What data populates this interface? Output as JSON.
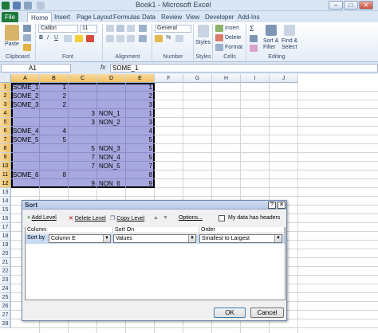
{
  "window": {
    "title": "Book1 - Microsoft Excel",
    "controls": [
      "−",
      "□",
      "✕"
    ]
  },
  "ribbon": {
    "tabs": [
      "File",
      "Home",
      "Insert",
      "Page Layout",
      "Formulas",
      "Data",
      "Review",
      "View",
      "Developer",
      "Add-Ins"
    ],
    "groups": {
      "clipboard": {
        "label": "Clipboard",
        "paste": "Paste"
      },
      "font": {
        "label": "Font",
        "name": "Calibri",
        "size": "11"
      },
      "alignment": {
        "label": "Alignment"
      },
      "number": {
        "label": "Number",
        "format": "General"
      },
      "styles": {
        "label": "Styles"
      },
      "cells": {
        "label": "Cells",
        "insert": "Insert",
        "delete": "Delete",
        "format": "Format"
      },
      "editing": {
        "label": "Editing",
        "sort_filter": "Sort &",
        "sort_filter2": "Filter",
        "find_select": "Find &",
        "find_select2": "Select"
      }
    }
  },
  "formula_bar": {
    "name_box": "A1",
    "fx": "fx",
    "content": "SOME_1"
  },
  "sheet": {
    "columns": [
      "A",
      "B",
      "C",
      "D",
      "E",
      "F",
      "G",
      "H",
      "I",
      "J"
    ],
    "rows": [
      "1",
      "2",
      "3",
      "4",
      "5",
      "6",
      "7",
      "8",
      "9",
      "10",
      "11",
      "12",
      "13",
      "14",
      "15",
      "16",
      "17",
      "18",
      "19",
      "20",
      "21",
      "22",
      "23",
      "24",
      "25",
      "26",
      "27",
      "28"
    ],
    "data": [
      [
        "SOME_1",
        "1",
        "",
        "",
        "1"
      ],
      [
        "SOME_2",
        "2",
        "",
        "",
        "2"
      ],
      [
        "SOME_3",
        "2",
        "",
        "",
        "3"
      ],
      [
        "",
        "",
        "3",
        "NON_1",
        "1"
      ],
      [
        "",
        "",
        "3",
        "NON_2",
        "3"
      ],
      [
        "SOME_4",
        "4",
        "",
        "",
        "4"
      ],
      [
        "SOME_5",
        "5",
        "",
        "",
        "5"
      ],
      [
        "",
        "",
        "5",
        "NON_3",
        "5"
      ],
      [
        "",
        "",
        "7",
        "NON_4",
        "5"
      ],
      [
        "",
        "",
        "7",
        "NON_5",
        "7"
      ],
      [
        "SOME_6",
        "8",
        "",
        "",
        "8"
      ],
      [
        "",
        "",
        "9",
        "NON_6",
        "9"
      ]
    ]
  },
  "sort_dialog": {
    "title": "Sort",
    "help": "?",
    "close": "✕",
    "toolbar": {
      "add_level": "Add Level",
      "delete_level": "Delete Level",
      "copy_level": "Copy Level",
      "options": "Options...",
      "my_data_has_headers": "My data has headers"
    },
    "headers": {
      "column": "Column",
      "sort_on": "Sort On",
      "order": "Order"
    },
    "row": {
      "label": "Sort by",
      "column": "Column E",
      "sort_on": "Values",
      "order": "Smallest to Largest"
    },
    "ok": "OK",
    "cancel": "Cancel"
  },
  "colors": {
    "selection_fill": "#a8a8e0",
    "file_tab": "#1d7a3a",
    "ribbon_bg": "#dfe8f5"
  }
}
